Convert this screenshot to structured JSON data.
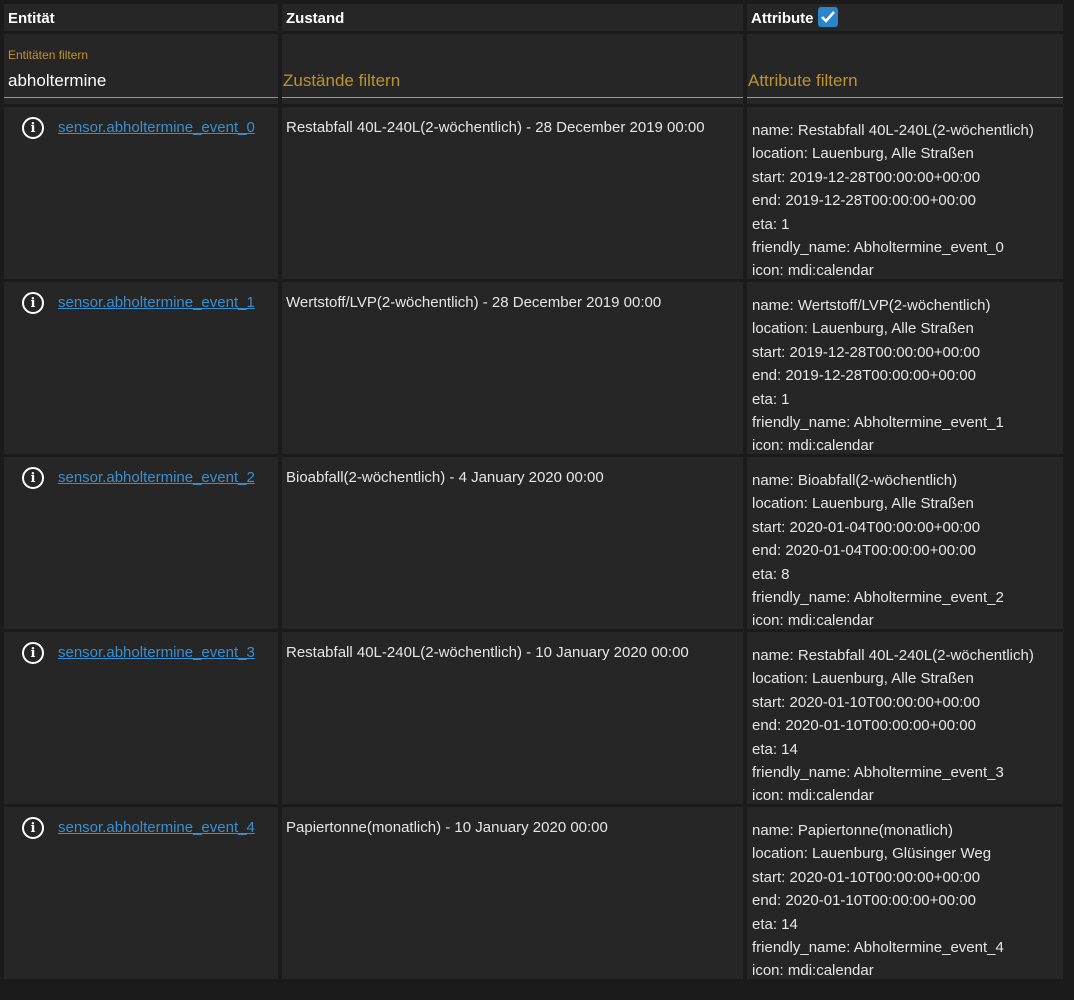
{
  "header": {
    "entity": "Entität",
    "state": "Zustand",
    "attributes": "Attribute",
    "attributes_checked": true
  },
  "filters": {
    "entity_label": "Entitäten filtern",
    "entity_value": "abholtermine",
    "state_placeholder": "Zustände filtern",
    "attributes_placeholder": "Attribute filtern"
  },
  "rows": [
    {
      "entity": "sensor.abholtermine_event_0",
      "state": "Restabfall 40L-240L(2-wöchentlich) - 28 December 2019 00:00",
      "attributes": [
        "name: Restabfall 40L-240L(2-wöchentlich)",
        "location: Lauenburg, Alle Straßen",
        "start: 2019-12-28T00:00:00+00:00",
        "end: 2019-12-28T00:00:00+00:00",
        "eta: 1",
        "friendly_name: Abholtermine_event_0",
        "icon: mdi:calendar"
      ]
    },
    {
      "entity": "sensor.abholtermine_event_1",
      "state": "Wertstoff/LVP(2-wöchentlich) - 28 December 2019 00:00",
      "attributes": [
        "name: Wertstoff/LVP(2-wöchentlich)",
        "location: Lauenburg, Alle Straßen",
        "start: 2019-12-28T00:00:00+00:00",
        "end: 2019-12-28T00:00:00+00:00",
        "eta: 1",
        "friendly_name: Abholtermine_event_1",
        "icon: mdi:calendar"
      ]
    },
    {
      "entity": "sensor.abholtermine_event_2",
      "state": "Bioabfall(2-wöchentlich) - 4 January 2020 00:00",
      "attributes": [
        "name: Bioabfall(2-wöchentlich)",
        "location: Lauenburg, Alle Straßen",
        "start: 2020-01-04T00:00:00+00:00",
        "end: 2020-01-04T00:00:00+00:00",
        "eta: 8",
        "friendly_name: Abholtermine_event_2",
        "icon: mdi:calendar"
      ]
    },
    {
      "entity": "sensor.abholtermine_event_3",
      "state": "Restabfall 40L-240L(2-wöchentlich) - 10 January 2020 00:00",
      "attributes": [
        "name: Restabfall 40L-240L(2-wöchentlich)",
        "location: Lauenburg, Alle Straßen",
        "start: 2020-01-10T00:00:00+00:00",
        "end: 2020-01-10T00:00:00+00:00",
        "eta: 14",
        "friendly_name: Abholtermine_event_3",
        "icon: mdi:calendar"
      ]
    },
    {
      "entity": "sensor.abholtermine_event_4",
      "state": "Papiertonne(monatlich) - 10 January 2020 00:00",
      "attributes": [
        "name: Papiertonne(monatlich)",
        "location: Lauenburg, Glüsinger Weg",
        "start: 2020-01-10T00:00:00+00:00",
        "end: 2020-01-10T00:00:00+00:00",
        "eta: 14",
        "friendly_name: Abholtermine_event_4",
        "icon: mdi:calendar"
      ]
    }
  ]
}
